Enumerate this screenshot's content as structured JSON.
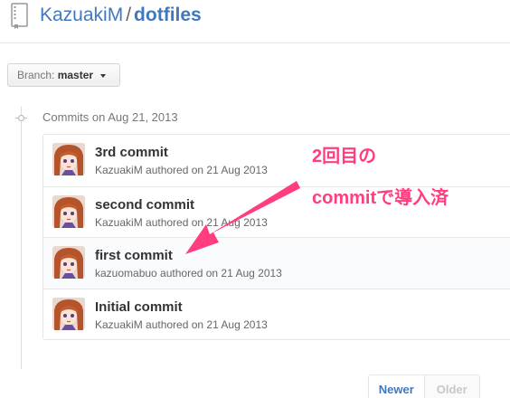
{
  "header": {
    "owner": "KazuakiM",
    "separator": "/",
    "repo": "dotfiles"
  },
  "branch": {
    "label": "Branch:",
    "value": "master"
  },
  "commits_heading": "Commits on Aug 21, 2013",
  "commits": [
    {
      "title": "3rd commit",
      "meta": "KazuakiM authored on 21 Aug 2013"
    },
    {
      "title": "second commit",
      "meta": "KazuakiM authored on 21 Aug 2013"
    },
    {
      "title": "first commit",
      "meta": "kazuomabuo authored on 21 Aug 2013"
    },
    {
      "title": "Initial commit",
      "meta": "KazuakiM authored on 21 Aug 2013"
    }
  ],
  "annotation": {
    "line1": "2回目の",
    "line2": "commitで導入済",
    "color": "#ff3d7f"
  },
  "pagination": {
    "newer": "Newer",
    "older": "Older"
  },
  "icons": {
    "repo": "repo-icon",
    "branch_caret": "chevron-down-icon",
    "timeline": "commit-node-icon",
    "avatar": "avatar"
  },
  "colors": {
    "link": "#4078c0",
    "muted": "#777777",
    "annotation": "#ff3d7f"
  }
}
